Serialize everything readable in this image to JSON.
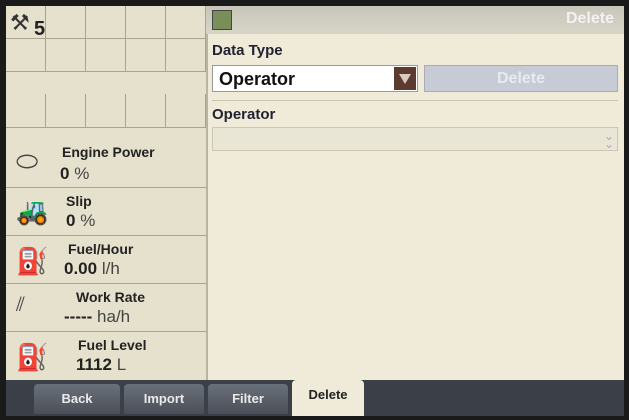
{
  "status": {
    "count": "5",
    "wrench_icon": "wrench-icon"
  },
  "gauges": [
    {
      "title": "Engine Power",
      "value": "0",
      "unit": "%",
      "icon": "engine-icon"
    },
    {
      "title": "Slip",
      "value": "0",
      "unit": "%",
      "icon": "tractor-slip-icon"
    },
    {
      "title": "Fuel/Hour",
      "value": "0.00",
      "unit": "l/h",
      "icon": "fuel-pump-icon"
    },
    {
      "title": "Work Rate",
      "value": "-----",
      "unit": "ha/h",
      "icon": "work-rate-icon"
    },
    {
      "title": "Fuel Level",
      "value": "1112",
      "unit": "L",
      "icon": "fuel-level-icon"
    }
  ],
  "header": {
    "title": "Delete",
    "icon": "app-icon"
  },
  "form": {
    "data_type_label": "Data Type",
    "data_type_value": "Operator",
    "delete_button": "Delete",
    "operator_label": "Operator",
    "operator_value": ""
  },
  "tabs": [
    {
      "label": "Back"
    },
    {
      "label": "Import"
    },
    {
      "label": "Filter"
    },
    {
      "label": "Delete",
      "active": true
    }
  ]
}
